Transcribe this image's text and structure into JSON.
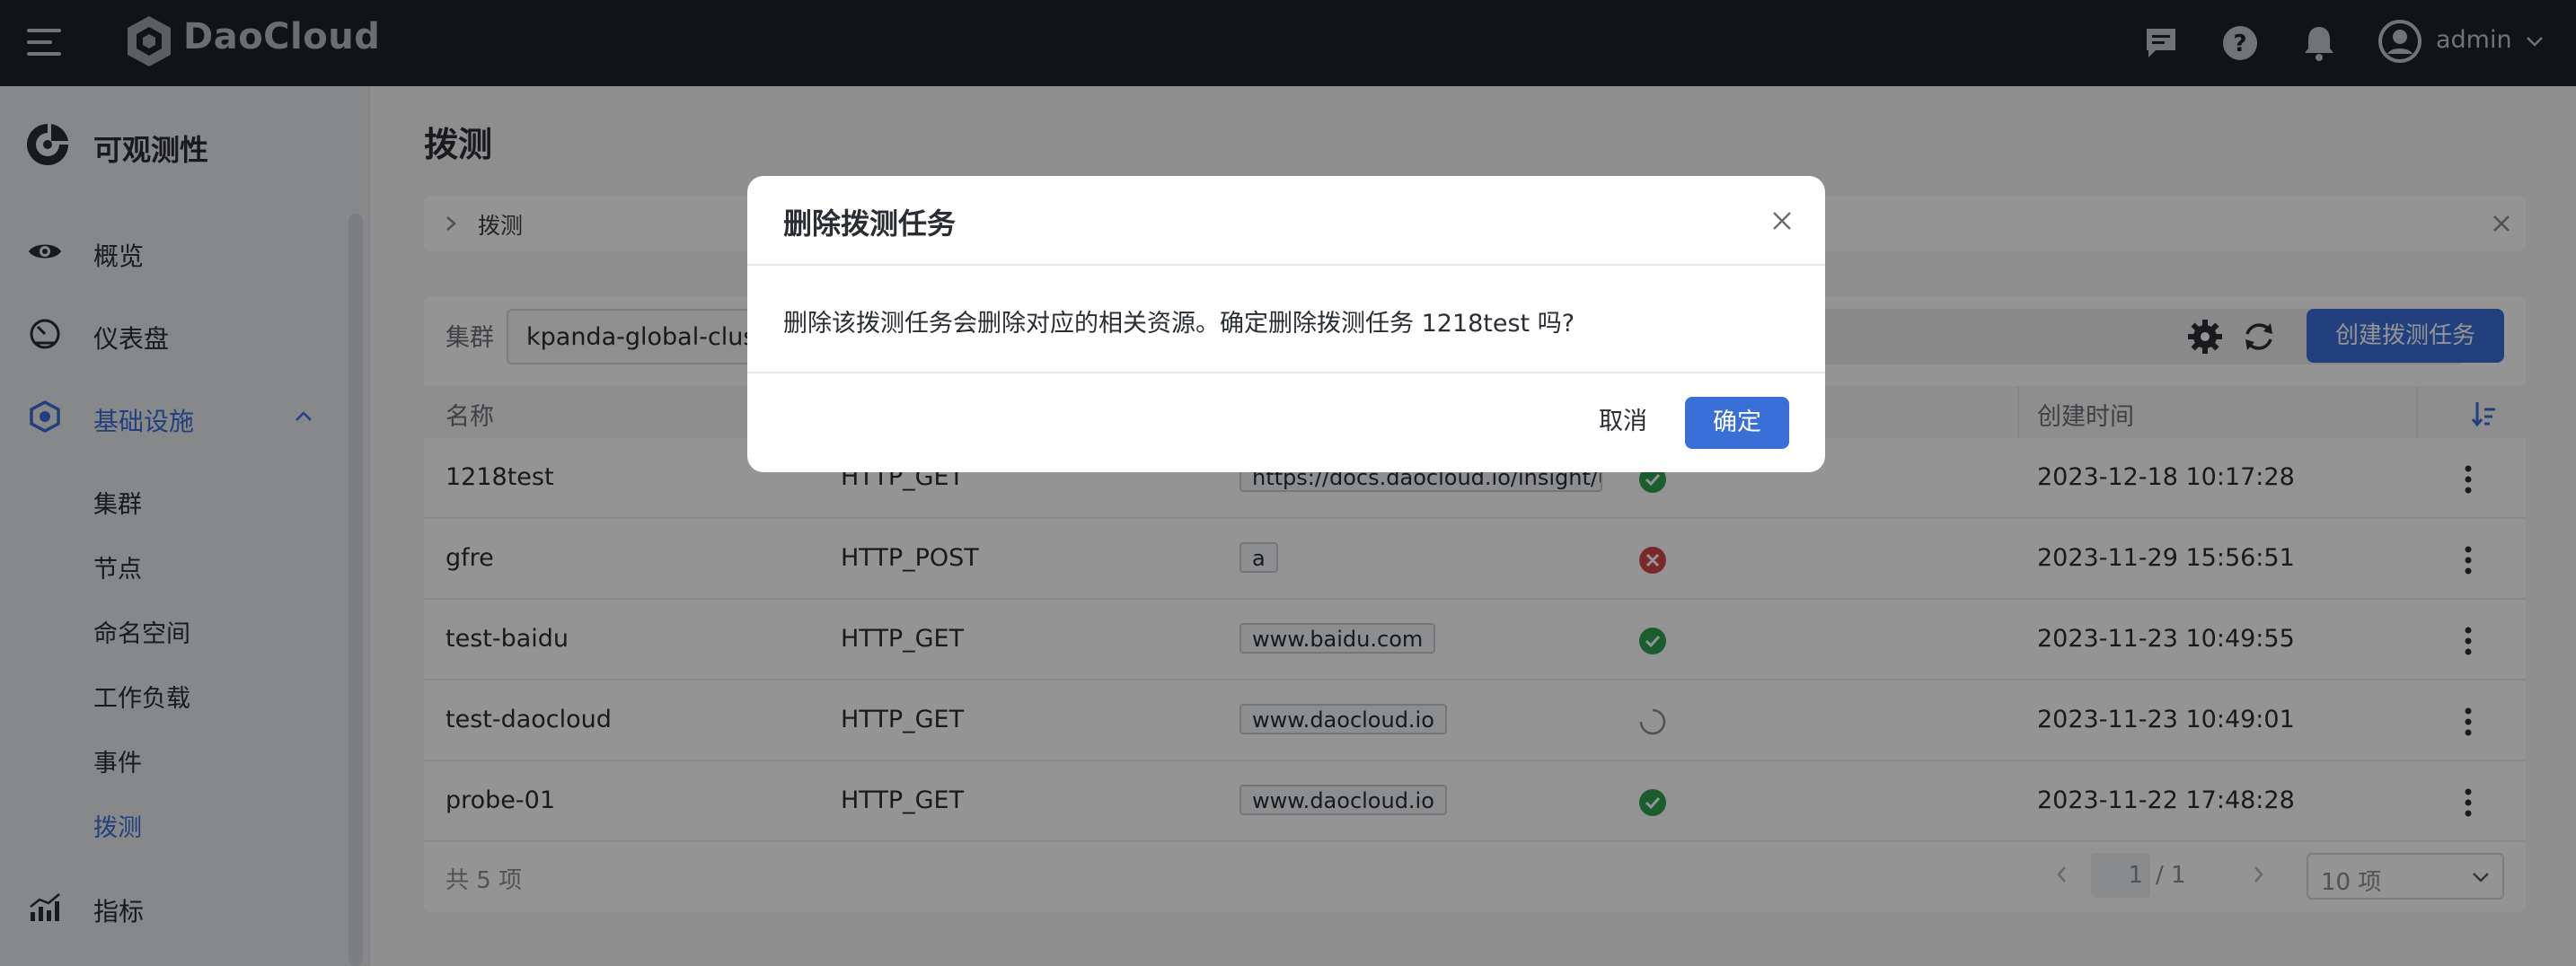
{
  "header": {
    "brand": "DaoCloud",
    "username": "admin"
  },
  "sidebar": {
    "title": "可观测性",
    "items": [
      {
        "label": "概览",
        "icon": "eye-icon"
      },
      {
        "label": "仪表盘",
        "icon": "gauge-icon"
      },
      {
        "label": "基础设施",
        "icon": "hexagon-icon"
      }
    ],
    "sub_items": [
      "集群",
      "节点",
      "命名空间",
      "工作负载",
      "事件",
      "拨测"
    ],
    "active_sub": "拨测",
    "bottom_item": {
      "label": "指标",
      "icon": "chart-icon"
    }
  },
  "page": {
    "title": "拨测",
    "info_text": "拨测"
  },
  "filter": {
    "label": "集群",
    "cluster_value": "kpanda-global-cluster",
    "create_button": "创建拨测任务"
  },
  "table": {
    "columns": [
      "名称",
      "创建时间"
    ],
    "rows": [
      {
        "name": "1218test",
        "method": "HTTP_GET",
        "target": "https://docs.daocloud.io/insight/u...",
        "status": "success",
        "created": "2023-12-18 10:17:28"
      },
      {
        "name": "gfre",
        "method": "HTTP_POST",
        "target": "a",
        "status": "error",
        "created": "2023-11-29 15:56:51"
      },
      {
        "name": "test-baidu",
        "method": "HTTP_GET",
        "target": "www.baidu.com",
        "status": "success",
        "created": "2023-11-23 10:49:55"
      },
      {
        "name": "test-daocloud",
        "method": "HTTP_GET",
        "target": "www.daocloud.io",
        "status": "pending",
        "created": "2023-11-23 10:49:01"
      },
      {
        "name": "probe-01",
        "method": "HTTP_GET",
        "target": "www.daocloud.io",
        "status": "success",
        "created": "2023-11-22 17:48:28"
      }
    ]
  },
  "footer": {
    "total": "共 5 项",
    "page_current": "1",
    "page_total": "/ 1",
    "page_size": "10 项"
  },
  "modal": {
    "title": "删除拨测任务",
    "message": "删除该拨测任务会删除对应的相关资源。确定删除拨测任务 1218test 吗?",
    "cancel": "取消",
    "confirm": "确定"
  },
  "colors": {
    "primary": "#3a6fd8",
    "topbar": "#1f2227",
    "success": "#2fa350",
    "error": "#d64545"
  }
}
